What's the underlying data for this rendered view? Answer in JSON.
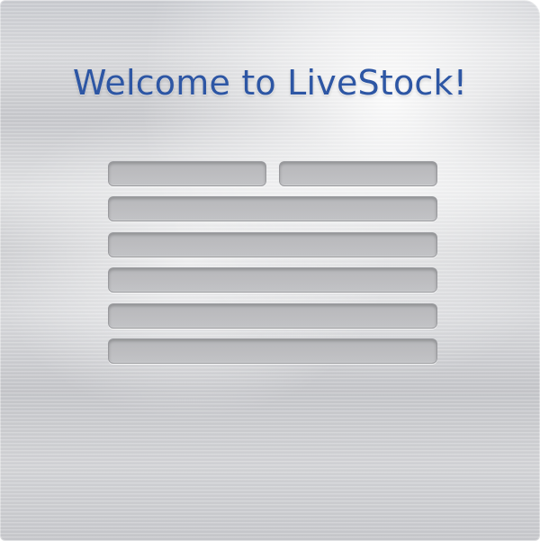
{
  "header": {
    "title": "Welcome to LiveStock!"
  },
  "form": {
    "fields": [
      {
        "value": "",
        "placeholder": ""
      },
      {
        "value": "",
        "placeholder": ""
      },
      {
        "value": "",
        "placeholder": ""
      },
      {
        "value": "",
        "placeholder": ""
      },
      {
        "value": "",
        "placeholder": ""
      },
      {
        "value": "",
        "placeholder": ""
      },
      {
        "value": "",
        "placeholder": ""
      }
    ]
  },
  "colors": {
    "title": "#2d56a4",
    "field_bg": "#bcbcbf",
    "panel_bg": "#d4d5d8"
  }
}
